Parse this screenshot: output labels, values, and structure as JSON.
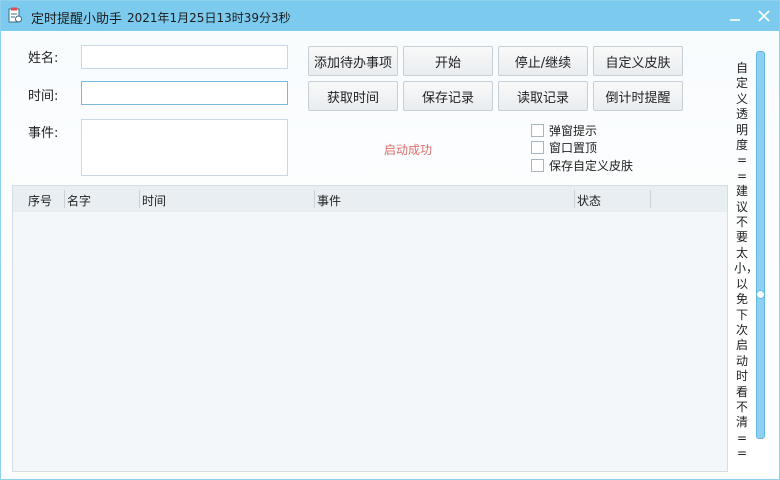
{
  "window": {
    "title": "定时提醒小助手",
    "datetime": "2021年1月25日13时39分3秒"
  },
  "form": {
    "name_label": "姓名:",
    "name_value": "",
    "time_label": "时间:",
    "time_value": "",
    "event_label": "事件:",
    "event_value": ""
  },
  "buttons": {
    "add_todo": "添加待办事项",
    "start": "开始",
    "stop_continue": "停止/继续",
    "custom_skin": "自定义皮肤",
    "get_time": "获取时间",
    "save_record": "保存记录",
    "read_record": "读取记录",
    "countdown": "倒计时提醒"
  },
  "status_text": "启动成功",
  "status_color": "#e06d6d",
  "options": {
    "popup": "弹窗提示",
    "topmost": "窗口置顶",
    "save_skin": "保存自定义皮肤"
  },
  "table": {
    "columns": [
      "序号",
      "名字",
      "时间",
      "事件",
      "状态"
    ],
    "rows": []
  },
  "transparency": {
    "label": "自定义透明度==建议不要太小，以免下次启动时看不清==",
    "level": 0.55
  },
  "colors": {
    "titlebar": "#7ccbee",
    "accent": "#5fb9e6"
  }
}
